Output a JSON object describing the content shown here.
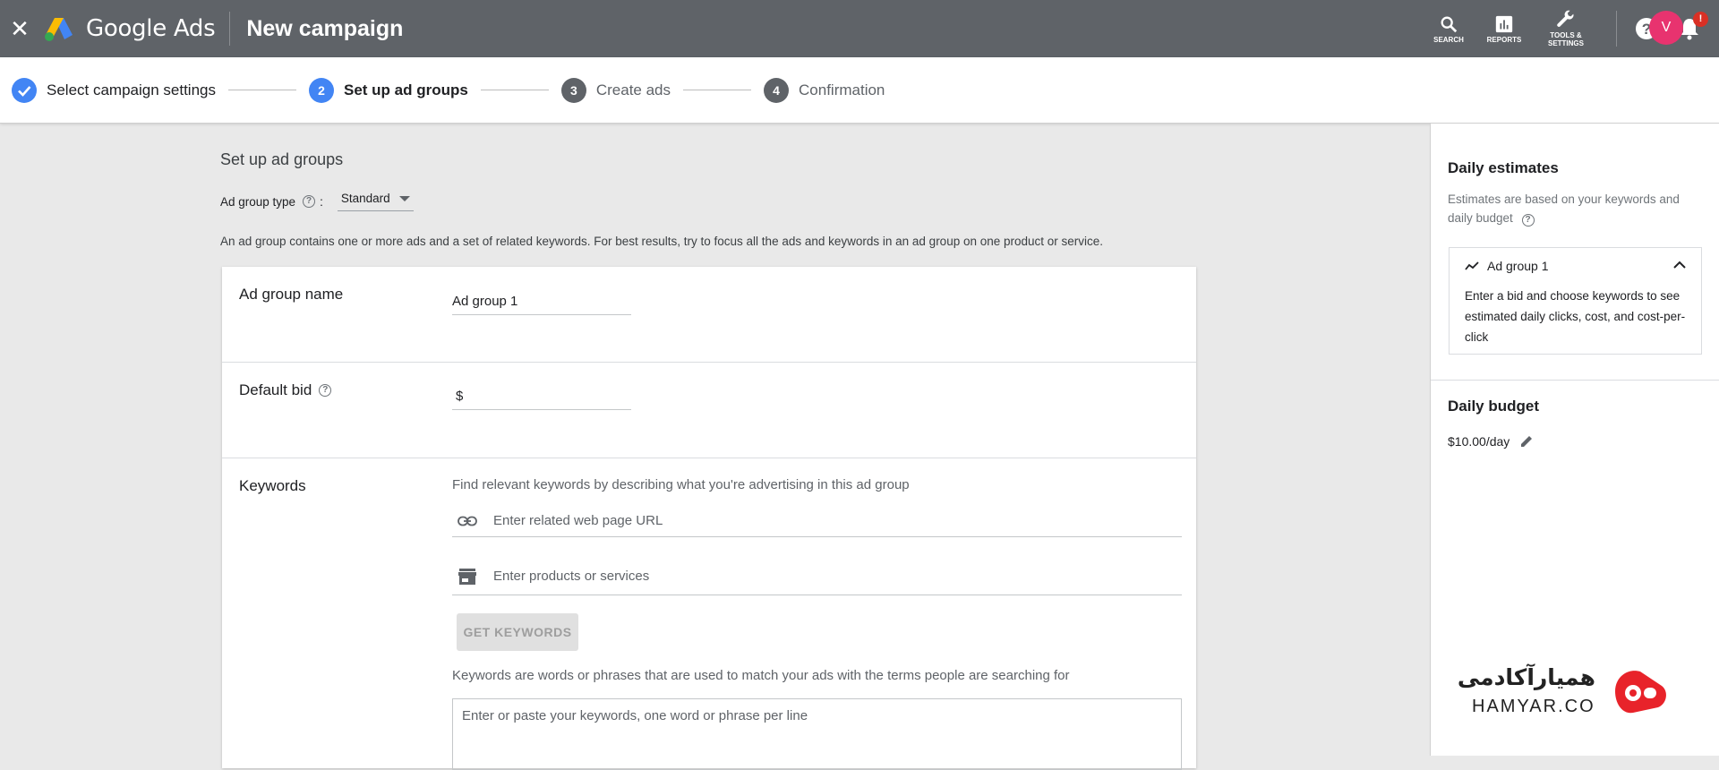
{
  "app": {
    "brand": "Google Ads",
    "title": "New campaign",
    "close_icon": "close-icon"
  },
  "toolbar": {
    "search_label": "SEARCH",
    "reports_label": "REPORTS",
    "tools_label_line1": "TOOLS &",
    "tools_label_line2": "SETTINGS",
    "notifications_badge": "!",
    "avatar_letter": "V"
  },
  "stepper": {
    "steps": [
      {
        "number": "✓",
        "label": "Select campaign settings",
        "state": "done"
      },
      {
        "number": "2",
        "label": "Set up ad groups",
        "state": "active"
      },
      {
        "number": "3",
        "label": "Create ads",
        "state": "todo"
      },
      {
        "number": "4",
        "label": "Confirmation",
        "state": "todo"
      }
    ]
  },
  "main": {
    "section_title": "Set up ad groups",
    "ad_group_type_label": "Ad group type",
    "ad_group_type_value": "Standard",
    "info_text": "An ad group contains one or more ads and a set of related keywords. For best results, try to focus all the ads and keywords in an ad group on one product or service.",
    "name_label": "Ad group name",
    "name_value": "Ad group 1",
    "bid_label": "Default bid",
    "bid_prefix": "$",
    "keywords_label": "Keywords",
    "keywords_hint": "Find relevant keywords by describing what you're advertising in this ad group",
    "url_placeholder": "Enter related web page URL",
    "products_placeholder": "Enter products or services",
    "get_keywords_button": "GET KEYWORDS",
    "keywords_explain": "Keywords are words or phrases that are used to match your ads with the terms people are searching for",
    "keywords_textarea_placeholder": "Enter or paste your keywords, one word or phrase per line"
  },
  "right_panel": {
    "daily_estimates_title": "Daily estimates",
    "estimates_sub": "Estimates are based on your keywords and daily budget",
    "ad_group_name": "Ad group 1",
    "ad_group_hint": "Enter a bid and choose keywords to see estimated daily clicks, cost, and cost-per-click",
    "daily_budget_title": "Daily budget",
    "daily_budget_value": "$10.00/day"
  },
  "watermark": {
    "text_fa": "همیارآکادمی",
    "text_en": "HAMYAR.CO"
  },
  "colors": {
    "topbar": "#5f6368",
    "accent_blue": "#4285f4",
    "step_todo": "#5f6368",
    "avatar": "#e8336f",
    "badge": "#d93025",
    "watermark_red": "#e8232a"
  }
}
